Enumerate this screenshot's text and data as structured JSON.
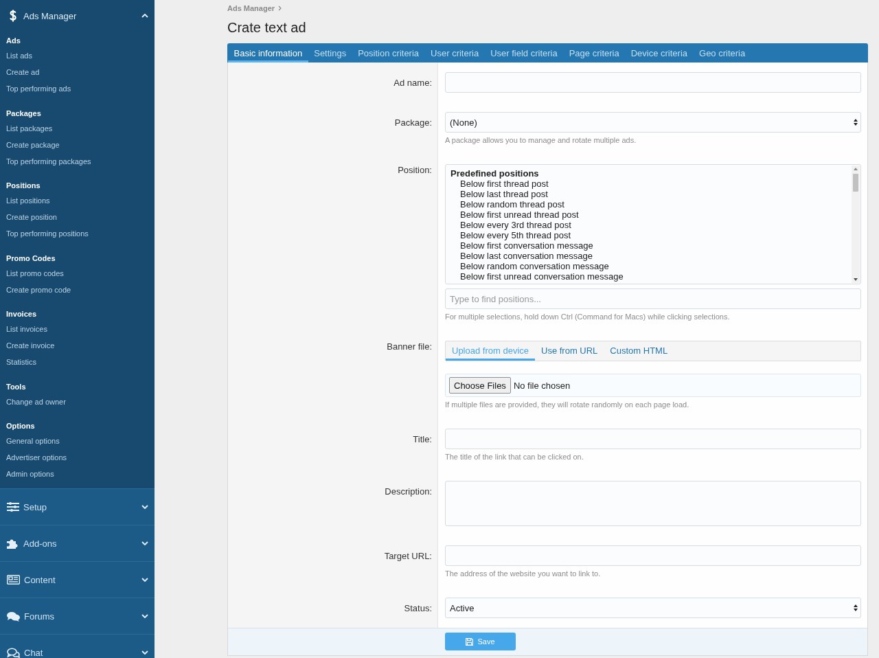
{
  "sidebar": {
    "header": {
      "label": "Ads Manager",
      "expanded": true
    },
    "sections": [
      {
        "heading": "Ads",
        "items": [
          "List ads",
          "Create ad",
          "Top performing ads"
        ]
      },
      {
        "heading": "Packages",
        "items": [
          "List packages",
          "Create package",
          "Top performing packages"
        ]
      },
      {
        "heading": "Positions",
        "items": [
          "List positions",
          "Create position",
          "Top performing positions"
        ]
      },
      {
        "heading": "Promo Codes",
        "items": [
          "List promo codes",
          "Create promo code"
        ]
      },
      {
        "heading": "Invoices",
        "items": [
          "List invoices",
          "Create invoice",
          "Statistics"
        ]
      },
      {
        "heading": "Tools",
        "items": [
          "Change ad owner"
        ]
      },
      {
        "heading": "Options",
        "items": [
          "General options",
          "Advertiser options",
          "Admin options"
        ]
      }
    ],
    "nav_groups": [
      {
        "label": "Setup",
        "expanded": false
      },
      {
        "label": "Add-ons",
        "expanded": false
      },
      {
        "label": "Content",
        "expanded": false
      },
      {
        "label": "Forums",
        "expanded": false
      },
      {
        "label": "Chat",
        "expanded": false
      }
    ]
  },
  "breadcrumb": [
    "Ads Manager"
  ],
  "page_title": "Crate text ad",
  "tabs": [
    {
      "label": "Basic information",
      "selected": true
    },
    {
      "label": "Settings",
      "selected": false
    },
    {
      "label": "Position criteria",
      "selected": false
    },
    {
      "label": "User criteria",
      "selected": false
    },
    {
      "label": "User field criteria",
      "selected": false
    },
    {
      "label": "Page criteria",
      "selected": false
    },
    {
      "label": "Device criteria",
      "selected": false
    },
    {
      "label": "Geo criteria",
      "selected": false
    }
  ],
  "form": {
    "rows": [
      {
        "kind": "text",
        "label": "Ad name:"
      },
      {
        "kind": "select",
        "label": "Package:",
        "value": "(None)",
        "hint": "A package allows you to manage and rotate multiple ads."
      },
      {
        "kind": "listbox",
        "label": "Position:",
        "group": "Predefined positions",
        "options": [
          {
            "label": "Below first thread post",
            "selected": false
          },
          {
            "label": "Below last thread post",
            "selected": false
          },
          {
            "label": "Below random thread post",
            "selected": false
          },
          {
            "label": "Below first unread thread post",
            "selected": false
          },
          {
            "label": "Below every 3rd thread post",
            "selected": false
          },
          {
            "label": "Below every 5th thread post",
            "selected": false
          },
          {
            "label": "Below first conversation message",
            "selected": false
          },
          {
            "label": "Below last conversation message",
            "selected": false
          },
          {
            "label": "Below random conversation message",
            "selected": false
          },
          {
            "label": "Below first unread conversation message",
            "selected": false
          }
        ],
        "search_placeholder": "Type to find positions...",
        "hint": "For multiple selections, hold down Ctrl (Command for Macs) while clicking selections."
      },
      {
        "kind": "banner",
        "label": "Banner file:",
        "tabs": [
          {
            "label": "Upload from device",
            "selected": true
          },
          {
            "label": "Use from URL",
            "selected": false
          },
          {
            "label": "Custom HTML",
            "selected": false
          }
        ],
        "file_button": "Choose Files",
        "file_status": "No file chosen",
        "hint": "If multiple files are provided, they will rotate randomly on each page load."
      },
      {
        "kind": "text",
        "label": "Title:",
        "hint": "The title of the link that can be clicked on."
      },
      {
        "kind": "textarea",
        "label": "Description:"
      },
      {
        "kind": "text",
        "label": "Target URL:",
        "hint": "The address of the website you want to link to."
      },
      {
        "kind": "select",
        "label": "Status:",
        "value": "Active"
      }
    ],
    "save_button": {
      "label": "Save"
    }
  }
}
